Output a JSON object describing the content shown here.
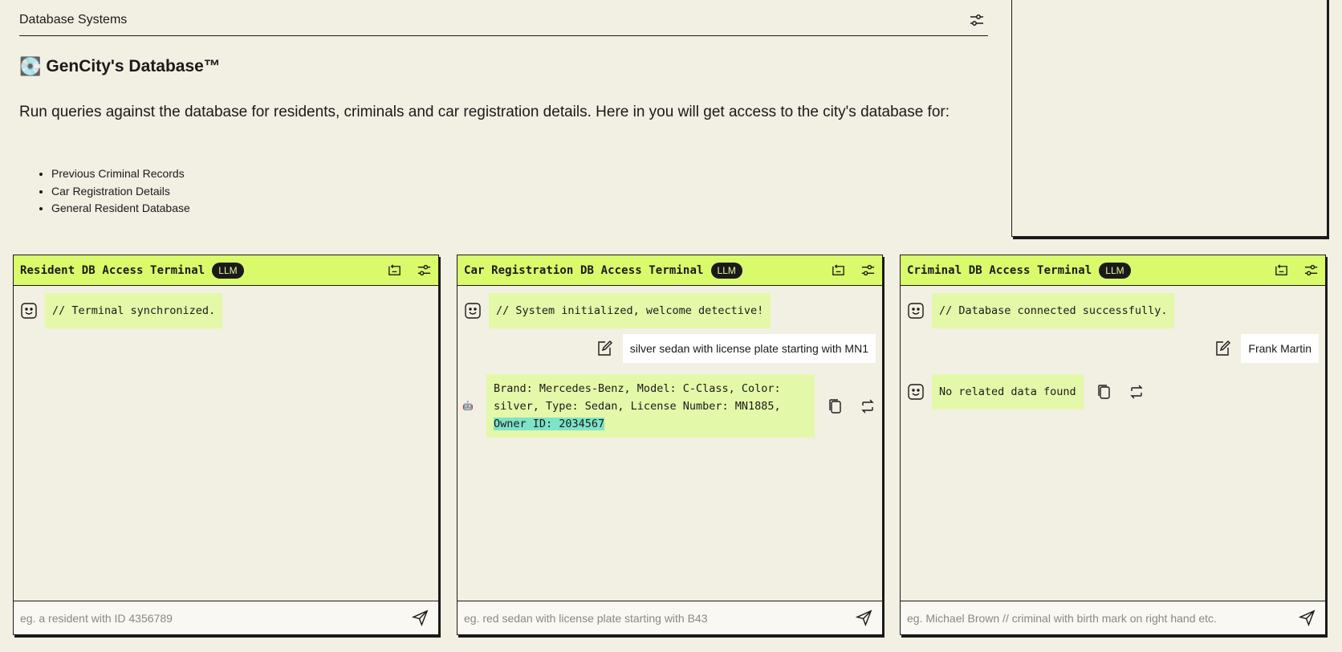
{
  "header": {
    "title": "Database Systems"
  },
  "main": {
    "title": "GenCity's Database™",
    "icon": "💽",
    "intro": "Run queries against the database for residents, criminals and car registration details. Here in you will get access to the city's database for:",
    "features": [
      "Previous Criminal Records",
      "Car Registration Details",
      "General Resident Database"
    ]
  },
  "terminals": {
    "resident": {
      "title": "Resident DB Access Terminal",
      "badge": "LLM",
      "welcome": "// Terminal synchronized.",
      "placeholder": "eg. a resident with ID 4356789"
    },
    "car": {
      "title": "Car Registration DB Access Terminal",
      "badge": "LLM",
      "welcome": "// System initialized, welcome detective!",
      "user_query": "silver sedan with license plate starting with MN1",
      "response_line1": "Brand: Mercedes-Benz, Model: C-Class, Color:",
      "response_line2": "silver, Type: Sedan, License Number: MN1885,",
      "response_highlight": "Owner ID: 2034567",
      "placeholder": "eg. red sedan with license plate starting with B43"
    },
    "criminal": {
      "title": "Criminal DB Access Terminal",
      "badge": "LLM",
      "welcome": "// Database connected successfully.",
      "user_query": "Frank Martin",
      "response": "No related data found",
      "placeholder": "eg. Michael Brown // criminal with birth mark on right hand etc."
    }
  },
  "colors": {
    "background": "#f2efe3",
    "header_accent": "#d9fb6b",
    "bot_bubble": "#e4f8a9",
    "highlight": "#7ee3c8",
    "ink": "#1a1a1a"
  },
  "icons": [
    "settings-sliders-icon",
    "refresh-chat-icon",
    "robot-face-icon",
    "edit-icon",
    "copy-icon",
    "regenerate-icon",
    "send-icon"
  ]
}
